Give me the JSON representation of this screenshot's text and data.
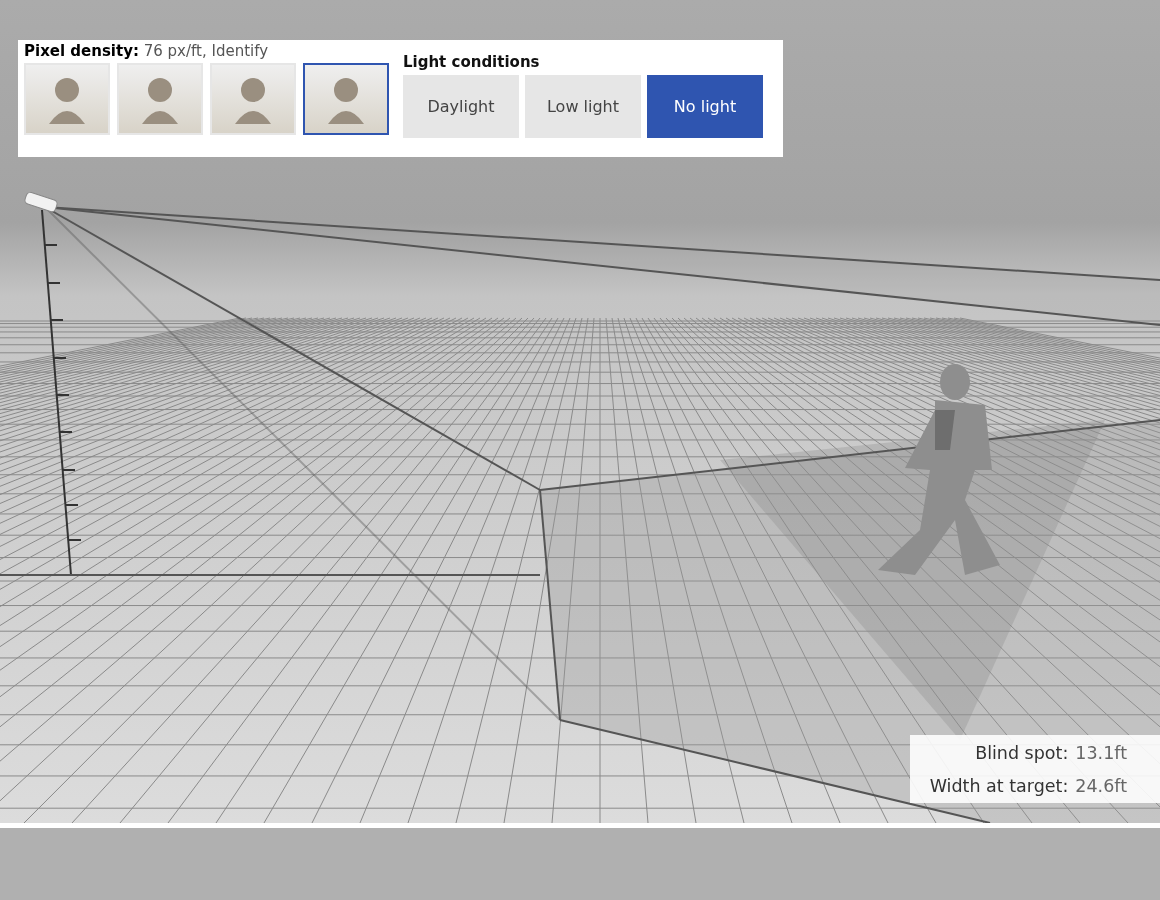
{
  "pixel_density": {
    "text": "**Pixel density:** 76 px/ft, Identify",
    "thumbnails": [
      {
        "selected": false
      },
      {
        "selected": false
      },
      {
        "selected": false
      },
      {
        "selected": true
      }
    ]
  },
  "light_conditions": {
    "label": "Light conditions",
    "options": [
      {
        "label": "Daylight",
        "selected": false
      },
      {
        "label": "Low light",
        "selected": false
      },
      {
        "label": "No light",
        "selected": true
      }
    ]
  },
  "measurements": [
    {
      "label": "Blind spot:",
      "value": "13.1ft"
    },
    {
      "label": "Width at target:",
      "value": "24.6ft"
    }
  ]
}
